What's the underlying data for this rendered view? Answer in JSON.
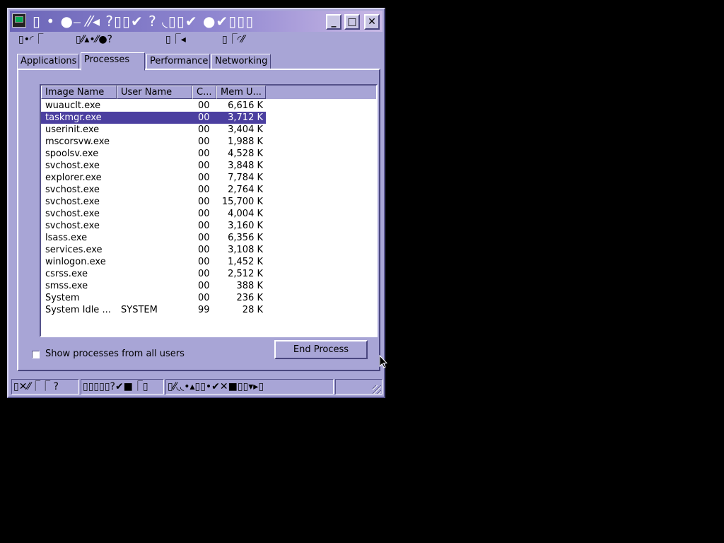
{
  "window": {
    "title_glyphs": "▯ • ●⎯ ⁄⁄◂ ?▯▯✔ ? ◟▯▯✔ ●✔▯▯▯",
    "buttons": {
      "minimize": "_",
      "maximize": "□",
      "close": "✕"
    }
  },
  "menubar": {
    "items": [
      "▯•◜⎾",
      "▯⁄⁄▴•⁄⁄●?",
      "▯⎾◂",
      "▯⎾◜⁄⁄"
    ]
  },
  "tabs": [
    {
      "label": "Applications",
      "active": false
    },
    {
      "label": "Processes",
      "active": true
    },
    {
      "label": "Performance",
      "active": false
    },
    {
      "label": "Networking",
      "active": false
    }
  ],
  "process_list": {
    "columns": [
      "Image Name",
      "User Name",
      "C...",
      "Mem U..."
    ],
    "rows": [
      {
        "name": "wuauclt.exe",
        "user": "",
        "cpu": "00",
        "mem": "6,616 K",
        "selected": false
      },
      {
        "name": "taskmgr.exe",
        "user": "",
        "cpu": "00",
        "mem": "3,712 K",
        "selected": true
      },
      {
        "name": "userinit.exe",
        "user": "",
        "cpu": "00",
        "mem": "3,404 K",
        "selected": false
      },
      {
        "name": "mscorsvw.exe",
        "user": "",
        "cpu": "00",
        "mem": "1,988 K",
        "selected": false
      },
      {
        "name": "spoolsv.exe",
        "user": "",
        "cpu": "00",
        "mem": "4,528 K",
        "selected": false
      },
      {
        "name": "svchost.exe",
        "user": "",
        "cpu": "00",
        "mem": "3,848 K",
        "selected": false
      },
      {
        "name": "explorer.exe",
        "user": "",
        "cpu": "00",
        "mem": "7,784 K",
        "selected": false
      },
      {
        "name": "svchost.exe",
        "user": "",
        "cpu": "00",
        "mem": "2,764 K",
        "selected": false
      },
      {
        "name": "svchost.exe",
        "user": "",
        "cpu": "00",
        "mem": "15,700 K",
        "selected": false
      },
      {
        "name": "svchost.exe",
        "user": "",
        "cpu": "00",
        "mem": "4,004 K",
        "selected": false
      },
      {
        "name": "svchost.exe",
        "user": "",
        "cpu": "00",
        "mem": "3,160 K",
        "selected": false
      },
      {
        "name": "lsass.exe",
        "user": "",
        "cpu": "00",
        "mem": "6,356 K",
        "selected": false
      },
      {
        "name": "services.exe",
        "user": "",
        "cpu": "00",
        "mem": "3,108 K",
        "selected": false
      },
      {
        "name": "winlogon.exe",
        "user": "",
        "cpu": "00",
        "mem": "1,452 K",
        "selected": false
      },
      {
        "name": "csrss.exe",
        "user": "",
        "cpu": "00",
        "mem": "2,512 K",
        "selected": false
      },
      {
        "name": "smss.exe",
        "user": "",
        "cpu": "00",
        "mem": "388 K",
        "selected": false
      },
      {
        "name": "System",
        "user": "",
        "cpu": "00",
        "mem": "236 K",
        "selected": false
      },
      {
        "name": "System Idle ...",
        "user": "SYSTEM",
        "cpu": "99",
        "mem": "28 K",
        "selected": false
      }
    ]
  },
  "show_all_users": {
    "label": "Show processes from all users",
    "checked": false
  },
  "end_process_button": "End Process",
  "statusbar": {
    "panes": [
      "▯✕⁄⁄⎾⎾ ?",
      "▯▯▯▯▯?✔■⎾▯",
      "▯⁄⁄◟◟•▴▯▯•✔✕■▯▯▾▸▯",
      ""
    ]
  },
  "colors": {
    "window_bg": "#a8a5d6",
    "selection_bg": "#4b3fa0",
    "title_gradient_start": "#6c66b8",
    "title_gradient_end": "#c9b9e6"
  }
}
